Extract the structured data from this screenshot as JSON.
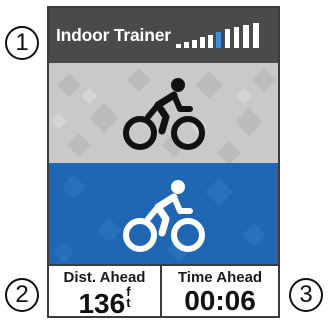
{
  "callouts": [
    "1",
    "2",
    "3"
  ],
  "header": {
    "title": "Indoor Trainer",
    "signal_icon": "signal-strength-icon"
  },
  "riders": {
    "top_icon": "cyclist-icon",
    "bottom_icon": "cyclist-icon"
  },
  "colors": {
    "header": "#4a4a4a",
    "gray_panel": "#c9c9c9",
    "blue_panel": "#1f66b3",
    "signal_highlight": "#3b8fe0"
  },
  "fields": {
    "left": {
      "label": "Dist. Ahead",
      "value": "136",
      "unit_top": "f",
      "unit_bottom": "t"
    },
    "right": {
      "label": "Time Ahead",
      "value": "00:06"
    }
  }
}
